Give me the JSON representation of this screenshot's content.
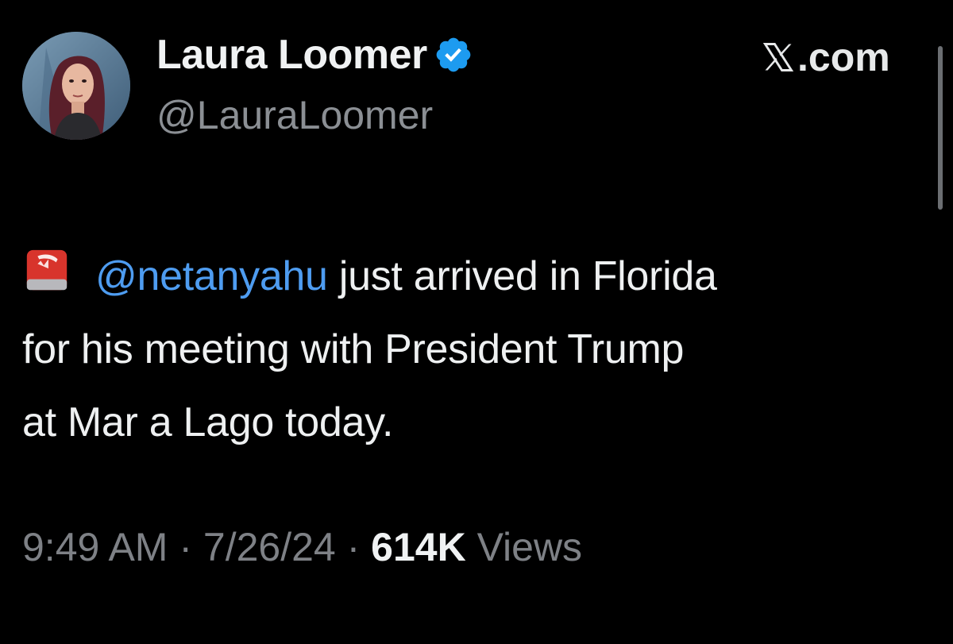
{
  "tweet": {
    "author": {
      "display_name": "Laura Loomer",
      "handle": "@LauraLoomer",
      "verified": true,
      "verified_color": "#1d9bf0"
    },
    "brand": {
      "label": ".com",
      "icon": "x-logo-icon"
    },
    "body": {
      "emoji": "police-siren-icon",
      "mention": "@netanyahu",
      "text_line1": " just arrived in Florida",
      "text_line2": "for his meeting with President Trump",
      "text_line3": "at Mar a Lago today."
    },
    "meta": {
      "time": "9:49 AM",
      "separator": " · ",
      "date": "7/26/24",
      "views_count": "614K",
      "views_label": " Views"
    }
  },
  "colors": {
    "background": "#000000",
    "mention": "#4e9cf0",
    "secondary_text": "#8b8f94"
  }
}
